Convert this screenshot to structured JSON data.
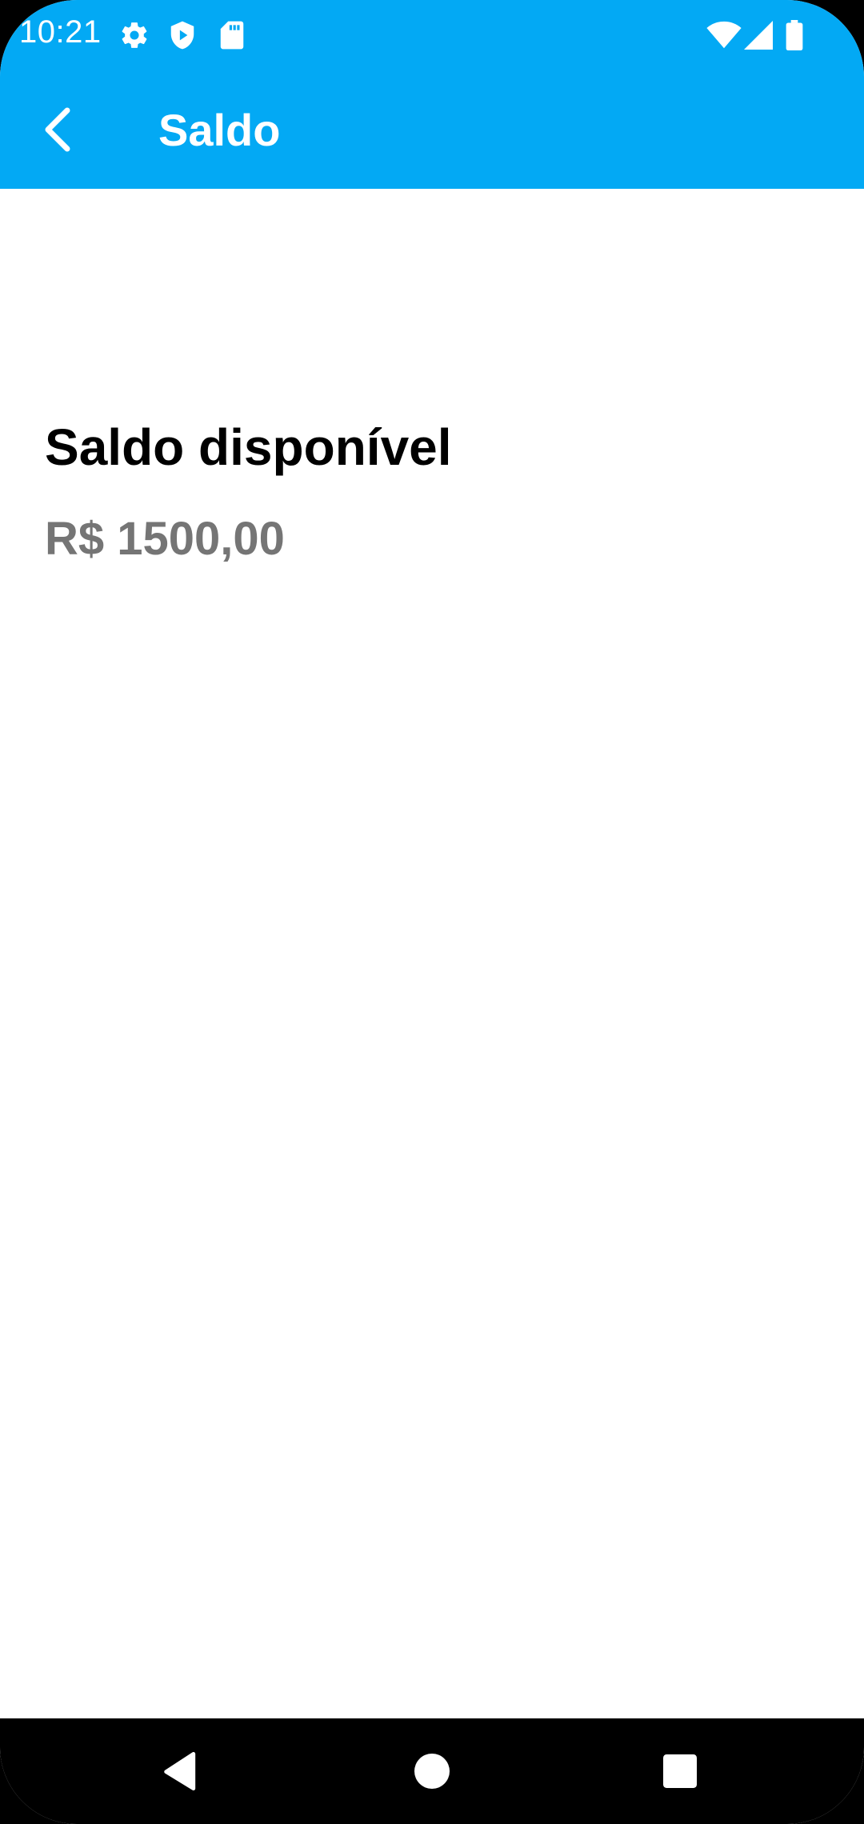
{
  "status_bar": {
    "time": "10:21",
    "left_icons": [
      "gear-icon",
      "shield-play-icon",
      "sd-card-icon"
    ],
    "right_icons": [
      "wifi-icon",
      "cell-signal-icon",
      "battery-icon"
    ]
  },
  "app_bar": {
    "title": "Saldo",
    "back_icon": "arrow-back-icon",
    "background_color": "#03A9F4"
  },
  "balance": {
    "label": "Saldo disponível",
    "value": "R$ 1500,00"
  },
  "nav_bar": {
    "buttons": [
      "nav-back-icon",
      "nav-home-icon",
      "nav-recents-icon"
    ]
  }
}
